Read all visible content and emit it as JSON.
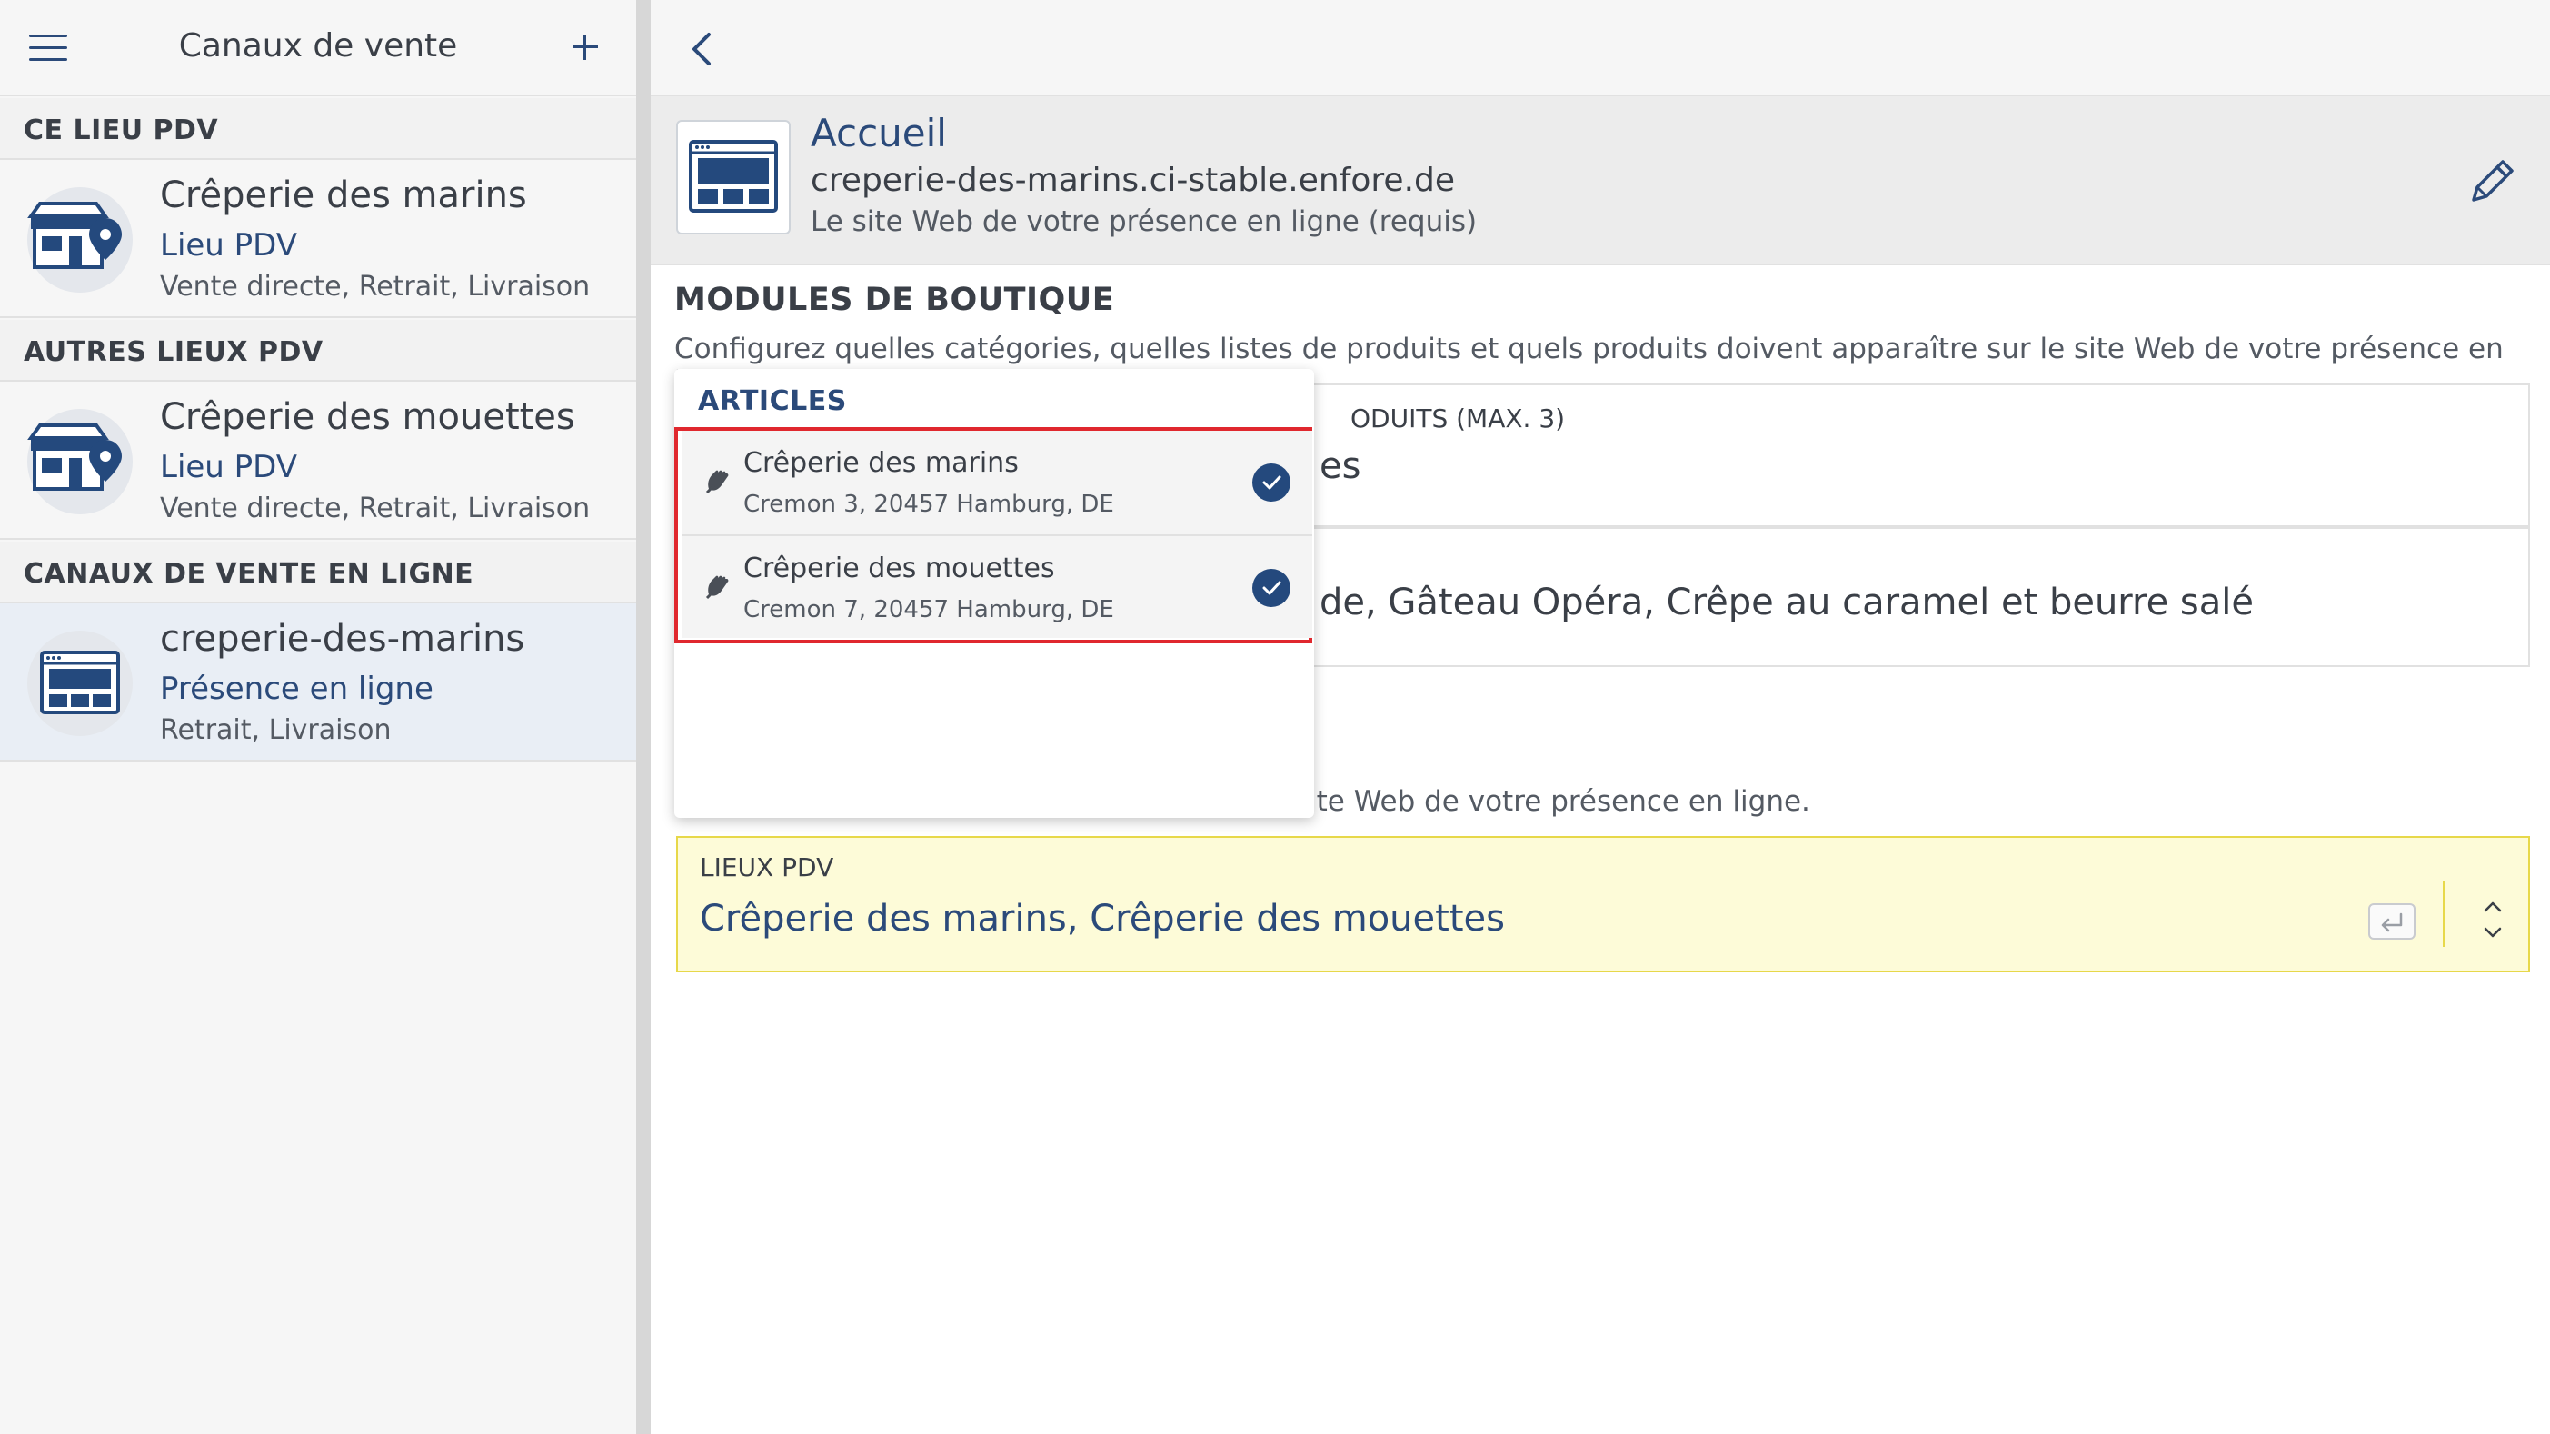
{
  "sidebar": {
    "title": "Canaux de vente",
    "sections": [
      {
        "label": "CE LIEU PDV"
      },
      {
        "label": "AUTRES LIEUX PDV"
      },
      {
        "label": "CANAUX DE VENTE EN LIGNE"
      }
    ],
    "channels": [
      {
        "name": "Crêperie des marins",
        "type": "Lieu PDV",
        "modes": "Vente directe, Retrait, Livraison",
        "icon": "store-location-icon"
      },
      {
        "name": "Crêperie des mouettes",
        "type": "Lieu PDV",
        "modes": "Vente directe, Retrait, Livraison",
        "icon": "store-location-icon"
      },
      {
        "name": "creperie-des-marins",
        "type": "Présence en ligne",
        "modes": "Retrait, Livraison",
        "icon": "website-icon",
        "selected": true
      }
    ]
  },
  "main": {
    "homepage": {
      "title": "Accueil",
      "url": "creperie-des-marins.ci-stable.enfore.de",
      "description": "Le site Web de votre présence en ligne (requis)"
    },
    "modules": {
      "heading": "MODULES DE BOUTIQUE",
      "description": "Configurez quelles catégories, quelles listes de produits et quels produits doivent apparaître sur le site Web de votre présence en ligne",
      "products_label": "ODUITS (MAX. 3)",
      "products_value": "es",
      "featured_value": "de, Gâteau Opéra, Crêpe au caramel et beurre salé"
    },
    "locations": {
      "description": "ite Web de votre présence en ligne.",
      "label": "LIEUX PDV",
      "value": "Crêperie des marins, Crêperie des mouettes"
    }
  },
  "dropdown": {
    "heading": "ARTICLES",
    "options": [
      {
        "name": "Crêperie des marins",
        "address": "Cremon 3, 20457 Hamburg, DE",
        "checked": true
      },
      {
        "name": "Crêperie des mouettes",
        "address": "Cremon 7, 20457 Hamburg, DE",
        "checked": true
      }
    ]
  },
  "colors": {
    "accent": "#2b4a7a",
    "highlight_border": "#e0282e",
    "locations_bg": "#fdfbd8",
    "locations_border": "#e7d84a"
  }
}
